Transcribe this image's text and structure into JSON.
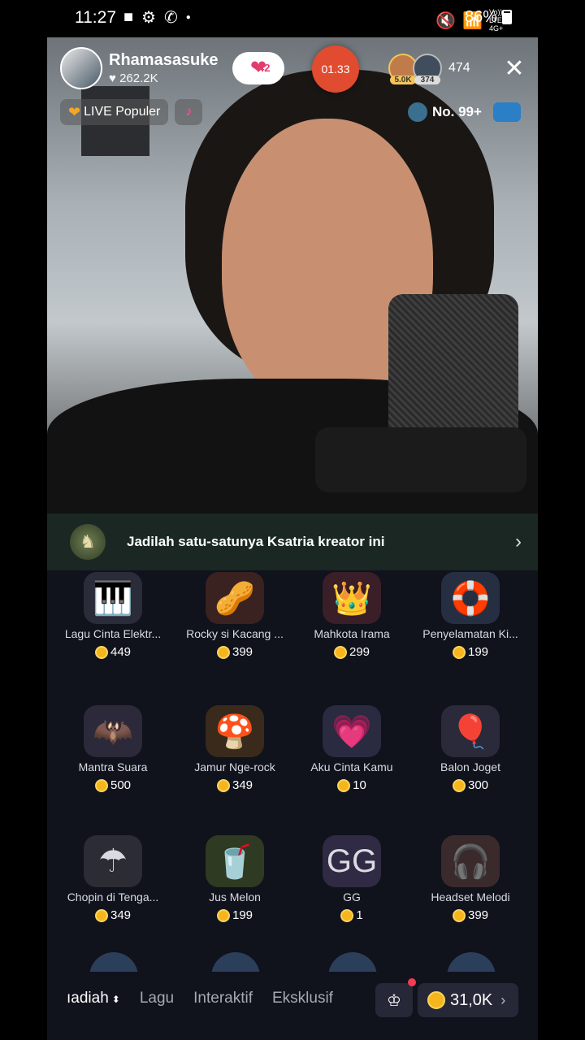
{
  "status_bar": {
    "time": "11:27",
    "battery": "86%",
    "network": "Vo)) LTE2 4G+",
    "icons": [
      "video-icon",
      "gear-icon",
      "whatsapp-icon",
      "dot-icon",
      "mute-icon",
      "signal-icon",
      "battery-icon"
    ]
  },
  "live": {
    "creator_name": "Rhamasasuke",
    "likes": "♥ 262.2K",
    "follow_badge": "42",
    "timer": "01.33",
    "viewer_badges": [
      "5.0K",
      "374"
    ],
    "viewer_count": "474",
    "chip_popular": "LIVE Populer",
    "rank": "No. 99+"
  },
  "banner": {
    "text": "Jadilah satu-satunya Ksatria kreator ini"
  },
  "gifts": [
    {
      "name": "Lagu Cinta Elektr...",
      "price": "449",
      "icon": "keyboard-gift-icon",
      "emoji": "🎹",
      "color": "#2a2c3a"
    },
    {
      "name": "Rocky si Kacang ...",
      "price": "399",
      "icon": "rocky-peanut-gift-icon",
      "emoji": "🥜",
      "color": "#3a2220"
    },
    {
      "name": "Mahkota Irama",
      "price": "299",
      "icon": "crown-keys-gift-icon",
      "emoji": "👑",
      "color": "#3a1e28"
    },
    {
      "name": "Penyelamatan Ki...",
      "price": "199",
      "icon": "rescue-gift-icon",
      "emoji": "🛟",
      "color": "#262f42"
    },
    {
      "name": "Mantra Suara",
      "price": "500",
      "icon": "bat-creature-gift-icon",
      "emoji": "🦇",
      "color": "#2c2a3a"
    },
    {
      "name": "Jamur Nge-rock",
      "price": "349",
      "icon": "mushroom-gift-icon",
      "emoji": "🍄",
      "color": "#3a2a1c"
    },
    {
      "name": "Aku Cinta Kamu",
      "price": "10",
      "icon": "i-love-you-gift-icon",
      "emoji": "💗",
      "color": "#2a2a40"
    },
    {
      "name": "Balon Joget",
      "price": "300",
      "icon": "dancing-balloon-gift-icon",
      "emoji": "🎈",
      "color": "#2a2a3a"
    },
    {
      "name": "Chopin di Tenga...",
      "price": "349",
      "icon": "umbrella-piano-gift-icon",
      "emoji": "☂",
      "color": "#2c2c34"
    },
    {
      "name": "Jus Melon",
      "price": "199",
      "icon": "melon-juice-gift-icon",
      "emoji": "🥤",
      "color": "#2f3a22"
    },
    {
      "name": "GG",
      "price": "1",
      "icon": "gg-gift-icon",
      "emoji": "GG",
      "color": "#302a44"
    },
    {
      "name": "Headset Melodi",
      "price": "399",
      "icon": "headset-gift-icon",
      "emoji": "🎧",
      "color": "#3a2a2c"
    }
  ],
  "bottom": {
    "tabs": [
      "ıadiah",
      "Lagu",
      "Interaktif",
      "Eksklusif"
    ],
    "balance": "31,0K"
  }
}
